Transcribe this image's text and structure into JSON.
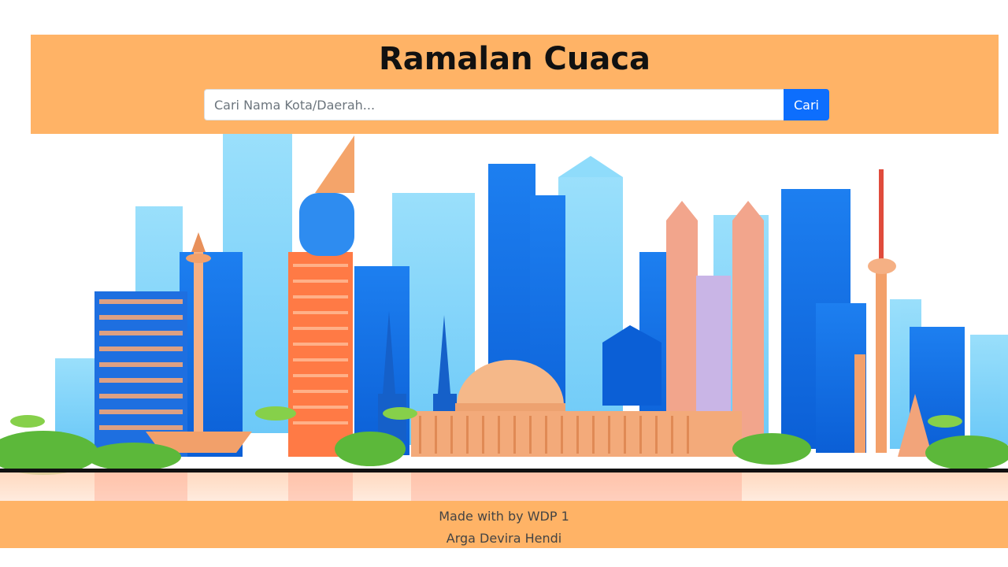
{
  "header": {
    "title": "Ramalan Cuaca",
    "search_placeholder": "Cari Nama Kota/Daerah...",
    "search_value": "",
    "search_button_label": "Cari"
  },
  "footer": {
    "credit_line": "Made with by WDP 1",
    "authors_line": "Arga Devira Hendi"
  },
  "colors": {
    "header_background": "#ffb366",
    "footer_background": "#ffb366",
    "button_background": "#0d6efd"
  },
  "illustration": {
    "icon": "city-skyline-illustration"
  }
}
